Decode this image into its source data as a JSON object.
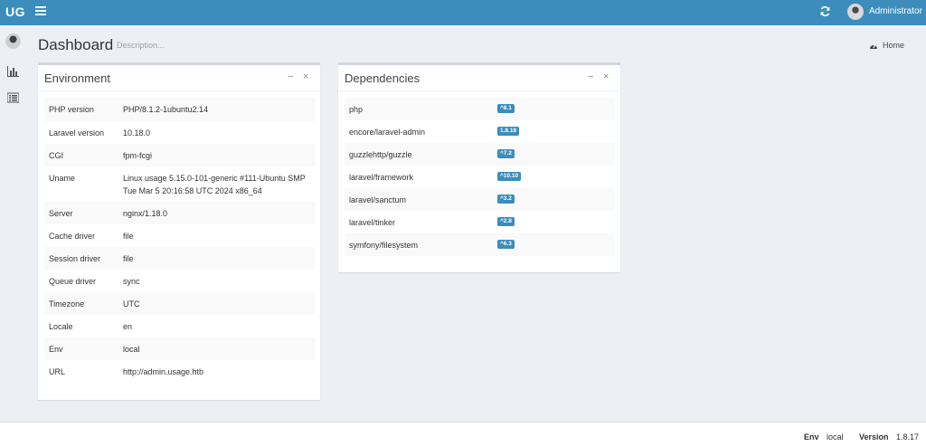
{
  "header": {
    "logo": "UG",
    "user_name": "Administrator",
    "icons": {
      "menu": "hamburger-icon",
      "refresh": "refresh-icon",
      "avatar": "user-avatar"
    }
  },
  "sidebar": {
    "items": [
      {
        "icon": "user-avatar"
      },
      {
        "icon": "bar-chart-icon"
      },
      {
        "icon": "list-icon"
      }
    ]
  },
  "page": {
    "title": "Dashboard",
    "description": "Description...",
    "breadcrumb_home": "Home"
  },
  "environment": {
    "title": "Environment",
    "rows": [
      {
        "key": "PHP version",
        "value": "PHP/8.1.2-1ubuntu2.14"
      },
      {
        "key": "Laravel version",
        "value": "10.18.0"
      },
      {
        "key": "CGI",
        "value": "fpm-fcgi"
      },
      {
        "key": "Uname",
        "value": "Linux usage 5.15.0-101-generic #111-Ubuntu SMP Tue Mar 5 20:16:58 UTC 2024 x86_64"
      },
      {
        "key": "Server",
        "value": "nginx/1.18.0"
      },
      {
        "key": "Cache driver",
        "value": "file"
      },
      {
        "key": "Session driver",
        "value": "file"
      },
      {
        "key": "Queue driver",
        "value": "sync"
      },
      {
        "key": "Timezone",
        "value": "UTC"
      },
      {
        "key": "Locale",
        "value": "en"
      },
      {
        "key": "Env",
        "value": "local"
      },
      {
        "key": "URL",
        "value": "http://admin.usage.htb"
      }
    ]
  },
  "dependencies": {
    "title": "Dependencies",
    "rows": [
      {
        "name": "php",
        "version": "^8.1"
      },
      {
        "name": "encore/laravel-admin",
        "version": "1.8.18"
      },
      {
        "name": "guzzlehttp/guzzle",
        "version": "^7.2"
      },
      {
        "name": "laravel/framework",
        "version": "^10.10"
      },
      {
        "name": "laravel/sanctum",
        "version": "^3.2"
      },
      {
        "name": "laravel/tinker",
        "version": "^2.8"
      },
      {
        "name": "symfony/filesystem",
        "version": "^6.3"
      }
    ]
  },
  "box_tools": {
    "collapse": "−",
    "close": "×"
  },
  "footer": {
    "env_label": "Env",
    "env_value": "local",
    "version_label": "Version",
    "version_value": "1.8.17"
  },
  "colors": {
    "header": "#3c8dbc",
    "badge": "#3c8dbc",
    "background": "#ecf0f5"
  }
}
